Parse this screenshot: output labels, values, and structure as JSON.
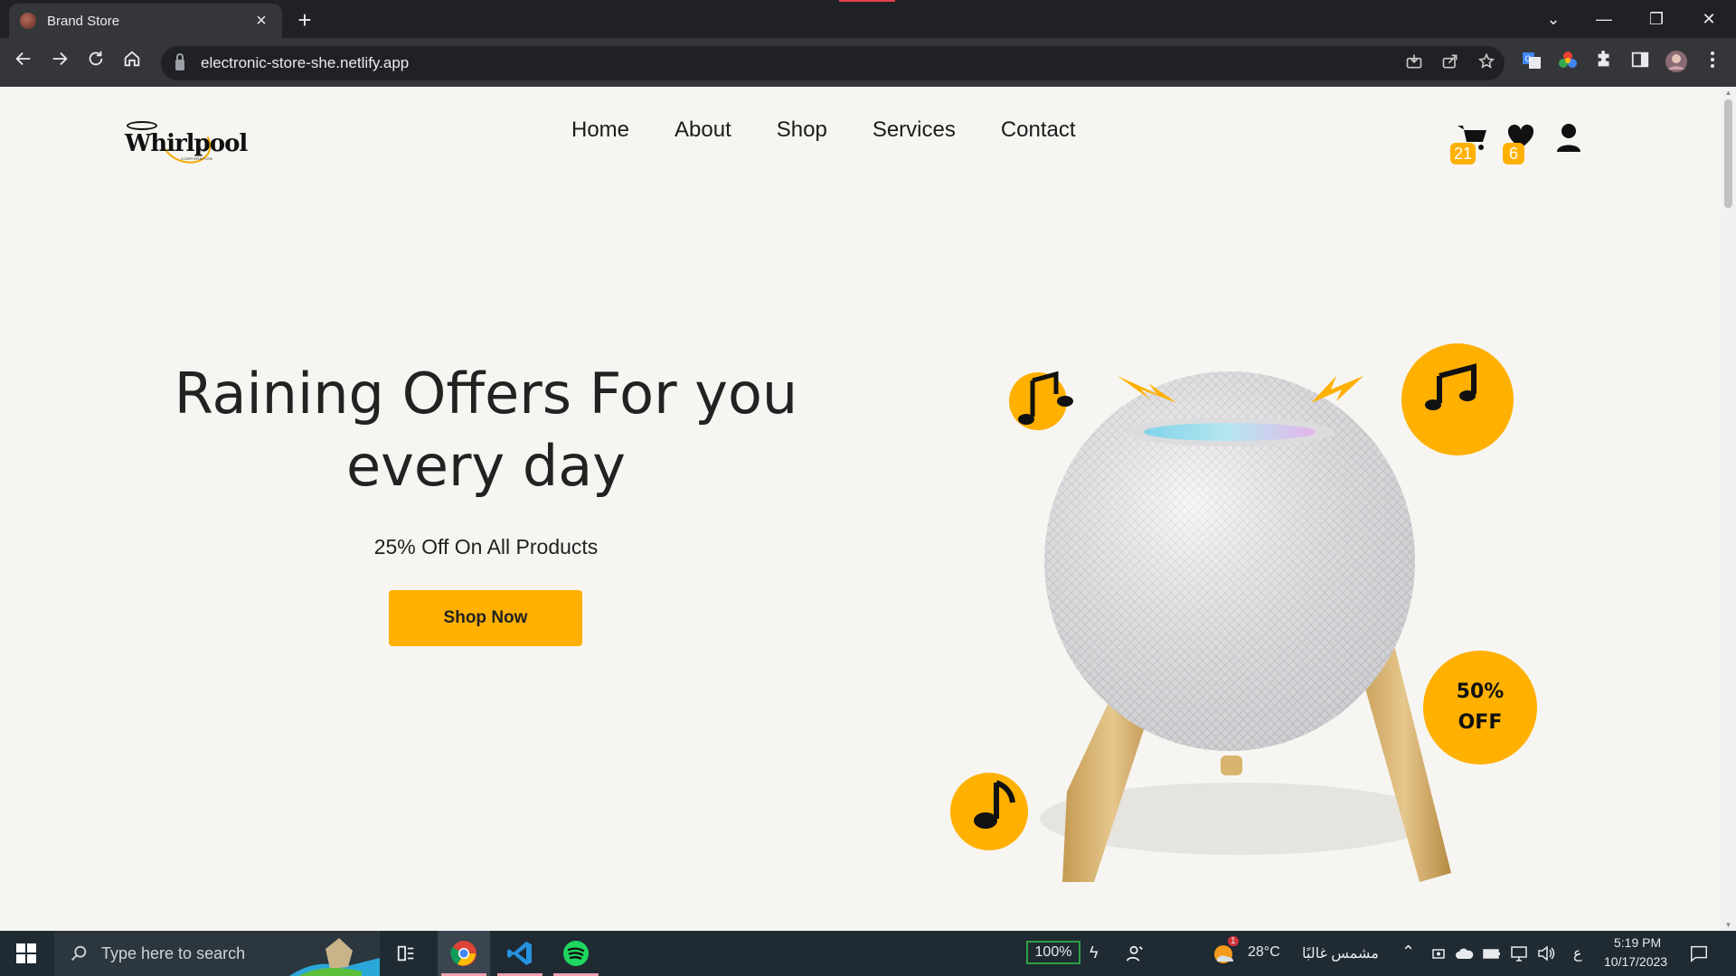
{
  "browser": {
    "tab_title": "Brand Store",
    "tab_close": "×",
    "new_tab": "+",
    "url": "electronic-store-she.netlify.app",
    "window_controls": {
      "minimize": "—",
      "restore": "❐",
      "close": "✕",
      "tab_search": "⌄"
    },
    "toolbar_icons": [
      "back-icon",
      "forward-icon",
      "reload-icon",
      "home-icon"
    ],
    "omnibox_icons": [
      "install-icon",
      "share-icon",
      "bookmark-star-icon"
    ],
    "extension_icons": [
      "translate-icon",
      "color-picker-icon",
      "extensions-puzzle-icon",
      "side-panel-icon",
      "profile-avatar-icon",
      "menu-kebab-icon"
    ]
  },
  "site": {
    "logo": {
      "text": "Whirlpool",
      "sub": "CORPORATION"
    },
    "nav": [
      "Home",
      "About",
      "Shop",
      "Services",
      "Contact"
    ],
    "cart_count": "21",
    "wishlist_count": "6",
    "hero": {
      "headline_line1": "Raining Offers For you",
      "headline_line2": "every day",
      "subline": "25% Off On All Products",
      "cta": "Shop Now",
      "promo_line1": "50%",
      "promo_line2": "OFF"
    },
    "accent_color": "#ffb000"
  },
  "taskbar": {
    "search_placeholder": "Type here to search",
    "battery": "100%",
    "weather_temp": "28°C",
    "weather_desc": "مشمس غالبًا",
    "lang": "ع",
    "time": "5:19 PM",
    "date": "10/17/2023",
    "weather_badge": "1"
  }
}
